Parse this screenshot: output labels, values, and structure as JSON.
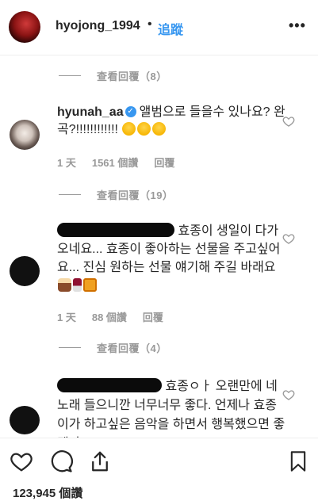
{
  "header": {
    "username": "hyojong_1994",
    "dot": "•",
    "follow_label": "追蹤",
    "more_label": "•••"
  },
  "replies_toggles": [
    {
      "label": "查看回覆（8）"
    },
    {
      "label": "查看回覆（19）"
    },
    {
      "label": "查看回覆（4）"
    }
  ],
  "comments": [
    {
      "username": "hyunah_aa",
      "verified": true,
      "text": "앨범으로 들을수 있나요? 완곡?!!!!!!!!!!!!",
      "time": "1 天",
      "likes": "1561 個讚",
      "reply_label": "回覆"
    },
    {
      "text": "효종이 생일이 다가오네요... 효종이 좋아하는 선물을 주고싶어요... 진심 원하는 선물 얘기해 주길 바래요",
      "time": "1 天",
      "likes": "88 個讚",
      "reply_label": "回覆"
    },
    {
      "text": "효종ㅇㅏ 오랜만에 네 노래 들으니깐 너무너무 좋다. 언제나 효종이가 하고싶은 음악을 하면서 행복했으면 좋겠다"
    }
  ],
  "footer": {
    "likes_count": "123,945 個讚"
  },
  "colors": {
    "accent": "#3897f0",
    "muted": "#999999",
    "text": "#262626"
  }
}
